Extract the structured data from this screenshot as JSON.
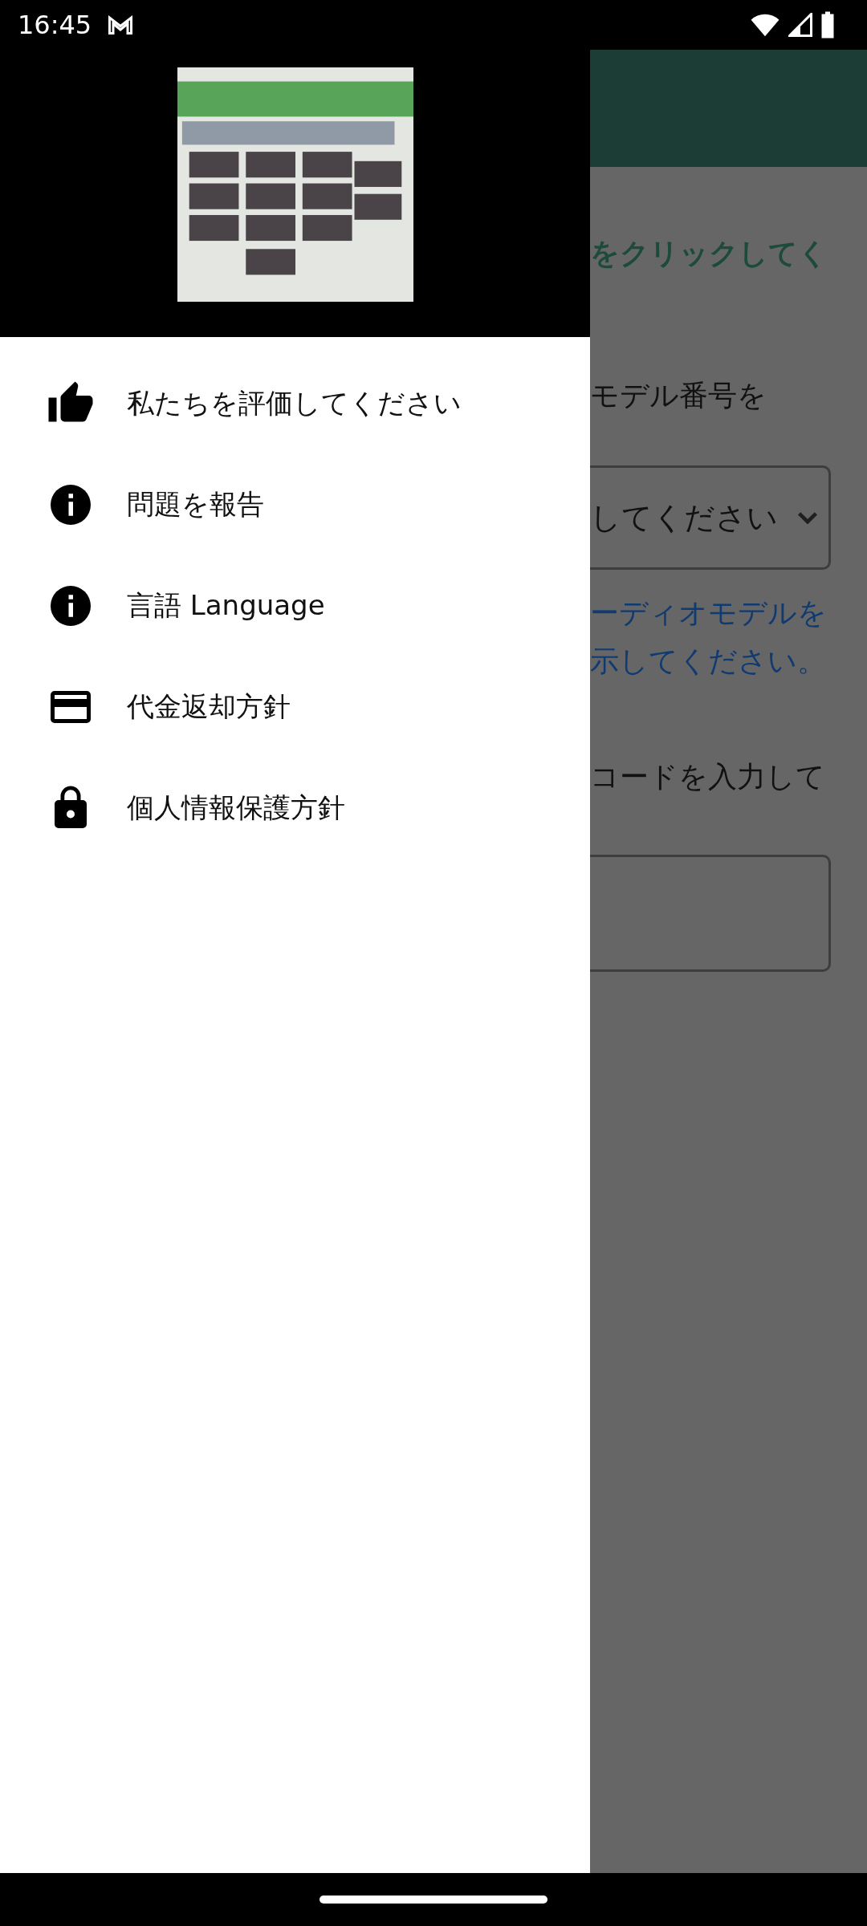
{
  "status_bar": {
    "time": "16:45"
  },
  "background": {
    "instruction": "をクリックしてく",
    "step_2": "モデル番号を",
    "dropdown": {
      "value": "してください"
    },
    "link_lines": [
      "ーディオモデルを",
      "示してください。"
    ],
    "step_3": "コードを入力して"
  },
  "drawer": {
    "items": [
      {
        "kind": "thumb",
        "label": "私たちを評価してください"
      },
      {
        "kind": "info",
        "label": "問題を報告"
      },
      {
        "kind": "info",
        "label": "言語 Language"
      },
      {
        "kind": "card",
        "label": "代金返却方針"
      },
      {
        "kind": "lock",
        "label": "個人情報保護方針"
      }
    ]
  }
}
